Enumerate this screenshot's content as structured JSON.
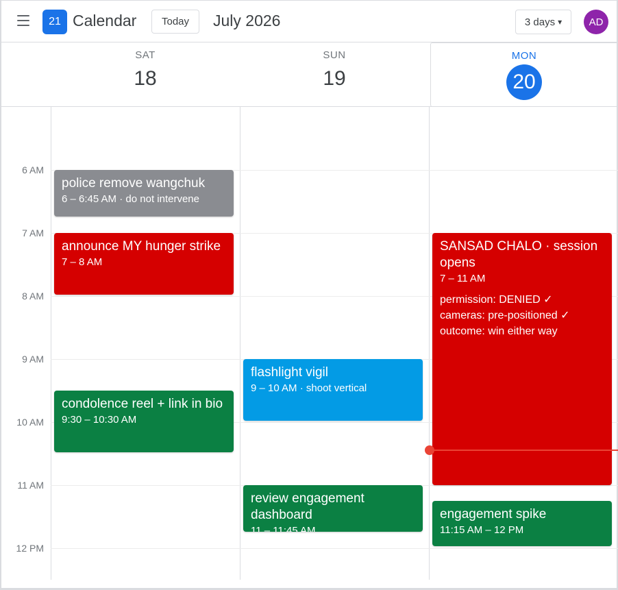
{
  "header": {
    "menu_icon": "hamburger-menu-icon",
    "logo_text": "21",
    "app_title": "Calendar",
    "today_label": "Today",
    "month_label": "July 2026",
    "view_label": "3 days",
    "view_caret": "▾",
    "avatar_initials": "AD",
    "avatar_color": "#8e24aa",
    "accent_color": "#1a73e8"
  },
  "days": [
    {
      "dow": "SAT",
      "date": "18",
      "is_today": false
    },
    {
      "dow": "SUN",
      "date": "19",
      "is_today": false
    },
    {
      "dow": "MON",
      "date": "20",
      "is_today": true
    }
  ],
  "time_labels": [
    "6 AM",
    "7 AM",
    "8 AM",
    "9 AM",
    "10 AM",
    "11 AM",
    "12 PM"
  ],
  "events": [
    {
      "day": "SAT",
      "title": "police remove wangchuk",
      "time": "6 – 6:45 AM",
      "note": "do not intervene",
      "color": "#8a8c91"
    },
    {
      "day": "SAT",
      "title": "announce MY hunger strike",
      "time": "7 – 8 AM",
      "color": "#d50000"
    },
    {
      "day": "SAT",
      "title": "condolence reel + link in bio",
      "time": "9:30 – 10:30 AM",
      "color": "#0b8043"
    },
    {
      "day": "SUN",
      "title": "flashlight vigil",
      "time": "9 – 10 AM",
      "note": "shoot vertical",
      "color": "#039be5"
    },
    {
      "day": "SUN",
      "title": "review engagement dashboard",
      "time": "11 – 11:45 AM",
      "color": "#0b8043"
    },
    {
      "day": "MON",
      "title": "SANSAD CHALO · session opens",
      "time": "7 – 11 AM",
      "color": "#d50000",
      "details": [
        "permission: DENIED ✓",
        "cameras: pre-positioned ✓",
        "outcome: win either way"
      ]
    },
    {
      "day": "MON",
      "title": "engagement spike",
      "time": "11:15 AM – 12 PM",
      "color": "#0b8043"
    }
  ],
  "now_indicator_color": "#ea4335",
  "separator": " · "
}
